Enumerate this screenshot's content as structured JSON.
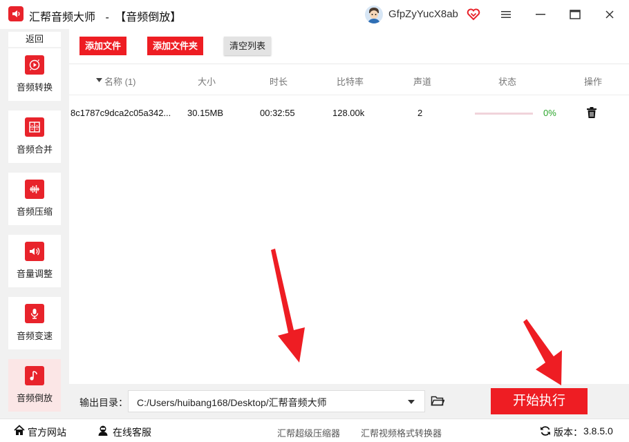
{
  "titlebar": {
    "app_name": "汇帮音频大师",
    "separator": "-",
    "mode": "【音频倒放】",
    "username": "GfpZyYucX8ab"
  },
  "sidebar": {
    "back_label": "返回",
    "items": [
      {
        "label": "音频转换",
        "icon": "audio-convert-icon"
      },
      {
        "label": "音频合并",
        "icon": "audio-merge-icon"
      },
      {
        "label": "音频压缩",
        "icon": "audio-compress-icon"
      },
      {
        "label": "音量调整",
        "icon": "volume-icon"
      },
      {
        "label": "音频变速",
        "icon": "microphone-icon"
      },
      {
        "label": "音频倒放",
        "icon": "music-note-icon",
        "active": true
      }
    ]
  },
  "toolbar": {
    "add_file": "添加文件",
    "add_folder": "添加文件夹",
    "clear_list": "清空列表"
  },
  "table": {
    "headers": {
      "name": "名称 (1)",
      "size": "大小",
      "duration": "时长",
      "bitrate": "比特率",
      "channels": "声道",
      "status": "状态",
      "action": "操作"
    },
    "rows": [
      {
        "name": "8c1787c9dca2c05a342...",
        "size": "30.15MB",
        "duration": "00:32:55",
        "bitrate": "128.00k",
        "channels": "2",
        "progress_percent": 0,
        "progress_text": "0%"
      }
    ]
  },
  "output": {
    "label": "输出目录：",
    "path": "C:/Users/huibang168/Desktop/汇帮音频大师",
    "start_label": "开始执行"
  },
  "statusbar": {
    "website": "官方网站",
    "support": "在线客服",
    "link1": "汇帮超级压缩器",
    "link2": "汇帮视频格式转换器",
    "version_label": "版本：",
    "version": "3.8.5.0"
  },
  "colors": {
    "brand_red": "#ee1d23",
    "progress_green": "#2aa52a",
    "sidebar_bg": "#f1f1f1"
  }
}
